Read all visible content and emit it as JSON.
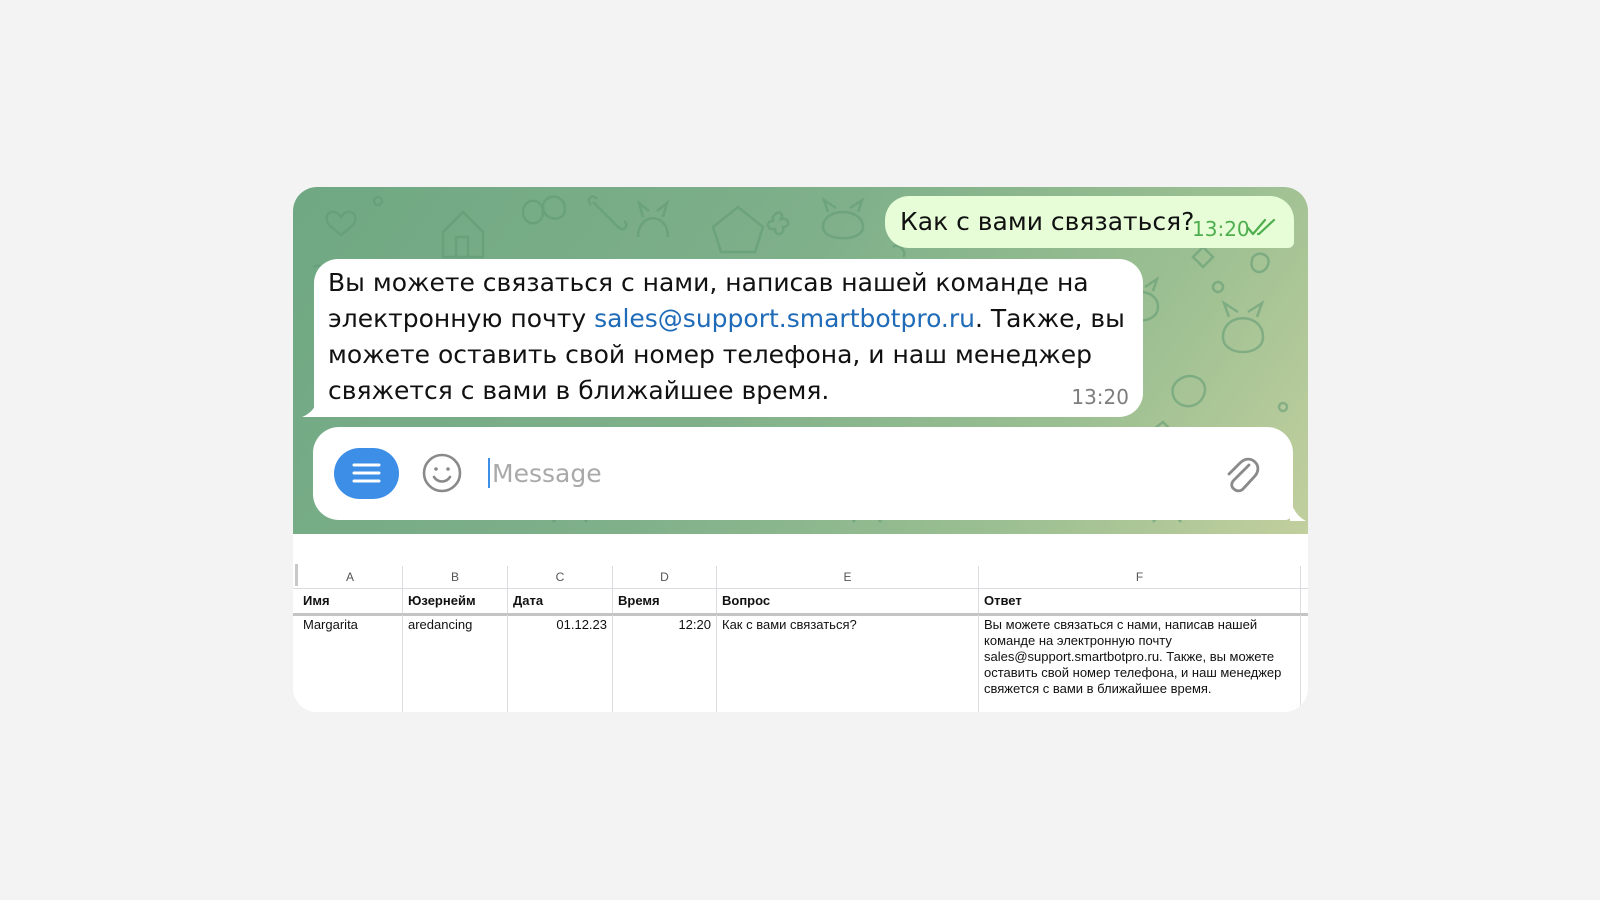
{
  "chat": {
    "outgoing": {
      "text": "Как с вами связаться?",
      "time": "13:20"
    },
    "incoming": {
      "text_before": "Вы можете связаться с нами, написав нашей команде на электронную почту ",
      "link": "sales@support.smartbotpro.ru",
      "text_after": ". Также, вы можете оставить свой номер телефона, и наш менеджер свяжется с вами в ближайшее время.",
      "time": "13:20"
    },
    "input": {
      "placeholder": "Message",
      "value": ""
    }
  },
  "sheet": {
    "column_letters": [
      "A",
      "B",
      "C",
      "D",
      "E",
      "F"
    ],
    "headers": [
      "Имя",
      "Юзернейм",
      "Дата",
      "Время",
      "Вопрос",
      "Ответ"
    ],
    "rows": [
      [
        "Margarita",
        "aredancing",
        "01.12.23",
        "12:20",
        "Как с вами связаться?",
        "Вы можете связаться с нами, написав нашей команде на электронную почту sales@support.smartbotpro.ru. Также, вы можете оставить свой номер телефона, и наш менеджер свяжется с вами в ближайшее время."
      ]
    ]
  },
  "colors": {
    "chat_bg": "#7fb08a",
    "outgoing_bubble": "#e6fdd8",
    "link": "#1f6bb8",
    "menu_button": "#3d8ee6",
    "time_outgoing": "#4fae4e"
  },
  "icons": {
    "menu": "hamburger-menu-icon",
    "emoji": "smiley-icon",
    "attach": "paperclip-icon",
    "read_status": "double-check-icon"
  }
}
